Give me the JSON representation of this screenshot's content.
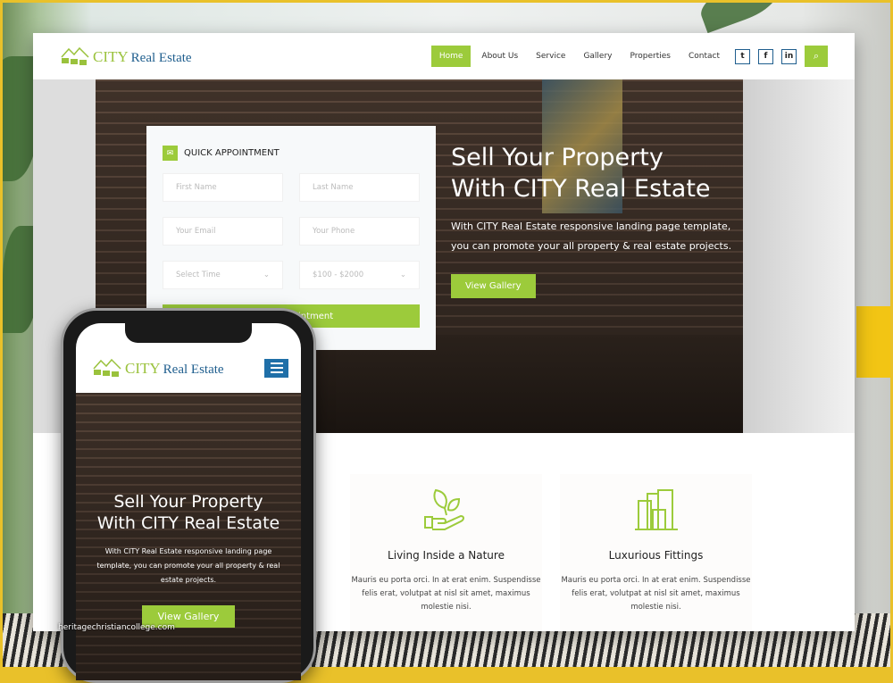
{
  "header": {
    "logo_city": "CITY",
    "logo_rest": "Real Estate",
    "nav": [
      "Home",
      "About Us",
      "Service",
      "Gallery",
      "Properties",
      "Contact"
    ],
    "social": [
      "twitter-icon",
      "facebook-icon",
      "linkedin-icon"
    ],
    "social_glyphs": [
      "t",
      "f",
      "in"
    ],
    "search_glyph": "⌕"
  },
  "form": {
    "title": "QUICK APPOINTMENT",
    "first_name": "First Name",
    "last_name": "Last Name",
    "email": "Your Email",
    "phone": "Your Phone",
    "time": "Select Time",
    "budget": "$100 - $2000",
    "submit": "Make Appointment"
  },
  "hero": {
    "title_line1": "Sell Your Property",
    "title_line2": "With CITY Real Estate",
    "text": "With CITY Real Estate responsive landing page template, you can promote your all property & real estate projects.",
    "button": "View Gallery"
  },
  "features": [
    {
      "icon": "plant-hand-icon",
      "title": "Living Inside a Nature",
      "text": "Mauris eu porta orci. In at erat enim. Suspendisse felis erat, volutpat at nisl sit amet, maximus molestie nisi."
    },
    {
      "icon": "buildings-icon",
      "title": "Luxurious Fittings",
      "text": "Mauris eu porta orci. In at erat enim. Suspendisse felis erat, volutpat at nisl sit amet, maximus molestie nisi."
    }
  ],
  "watermark": "heritagechristiancollege.com",
  "colors": {
    "accent": "#9ccb3b",
    "brand_blue": "#1f5e8e",
    "frame": "#e9c12a"
  }
}
